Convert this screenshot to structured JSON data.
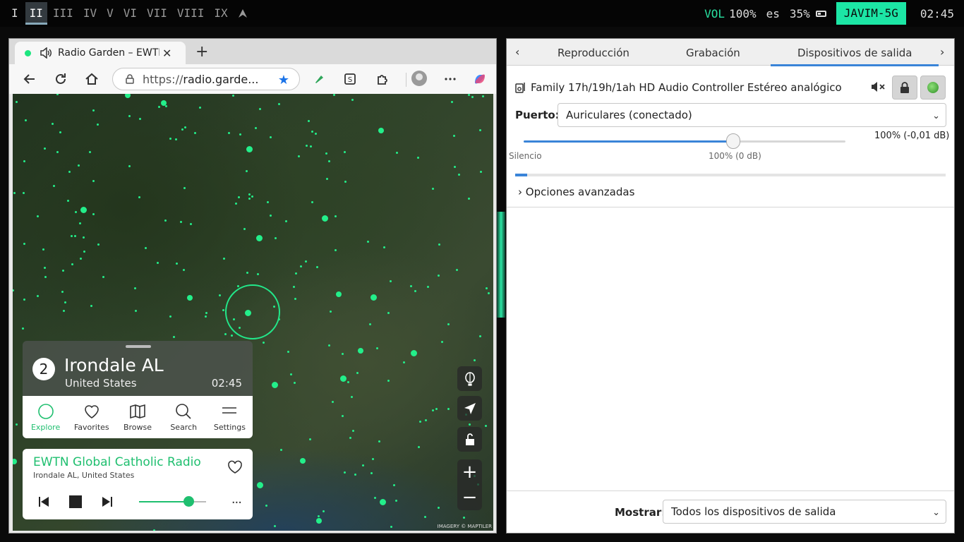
{
  "topbar": {
    "workspaces": [
      "I",
      "II",
      "III",
      "IV",
      "V",
      "VI",
      "VII",
      "VIII",
      "IX"
    ],
    "active_workspace": "II",
    "vol_label": "VOL",
    "vol_value": "100%",
    "lang": "es",
    "battery": "35%",
    "wifi": "JAVIM-5G",
    "clock": "02:45",
    "accent": "#1ce6a5"
  },
  "browser": {
    "tab_title": "Radio Garden – EWTN",
    "url_scheme": "https://",
    "url_host": "radio.garde...",
    "station_card": {
      "count": "2",
      "place": "Irondale AL",
      "country": "United States",
      "time": "02:45",
      "nav": [
        "Explore",
        "Favorites",
        "Browse",
        "Search",
        "Settings"
      ],
      "active_nav": "Explore"
    },
    "player": {
      "station": "EWTN Global Catholic Radio",
      "location": "Irondale AL, United States",
      "volume_fraction": 0.72,
      "more": "···"
    },
    "map_credit": "IMAGERY © MAPTILER",
    "zoom_in": "+",
    "zoom_out": "−",
    "accent": "#23ef8a"
  },
  "pavucontrol": {
    "tabs": [
      "Reproducción",
      "Grabación",
      "Dispositivos de salida"
    ],
    "active_tab": "Dispositivos de salida",
    "device_name": "Family 17h/19h/1ah HD Audio Controller Estéreo analógico",
    "port_label": "Puerto:",
    "port_value": "Auriculares (conectado)",
    "slider_min_label": "Silencio",
    "slider_mid_label": "100% (0 dB)",
    "volume_readout": "100% (-0,01 dB)",
    "volume_fraction": 0.66,
    "advanced": "Opciones avanzadas",
    "show_label": "Mostrar:",
    "show_value": "Todos los dispositivos de salida"
  }
}
